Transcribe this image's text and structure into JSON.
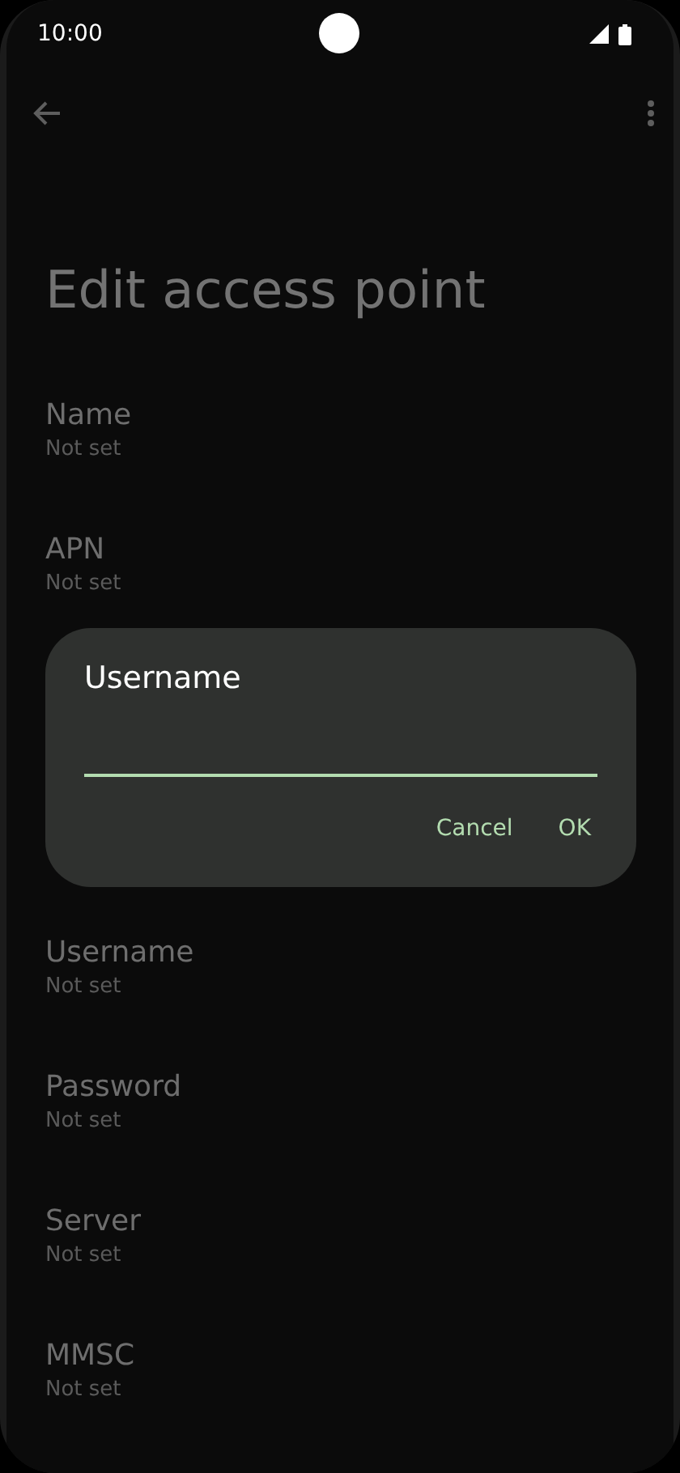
{
  "status_bar": {
    "time": "10:00"
  },
  "top_bar": {
    "title": "Edit access point"
  },
  "settings": [
    {
      "title": "Name",
      "summary": "Not set"
    },
    {
      "title": "APN",
      "summary": "Not set"
    },
    {
      "title": "Username",
      "summary": "Not set"
    },
    {
      "title": "Password",
      "summary": "Not set"
    },
    {
      "title": "Server",
      "summary": "Not set"
    },
    {
      "title": "MMSC",
      "summary": "Not set"
    }
  ],
  "dialog": {
    "title": "Username",
    "buttons": [
      "Cancel",
      "OK"
    ]
  }
}
